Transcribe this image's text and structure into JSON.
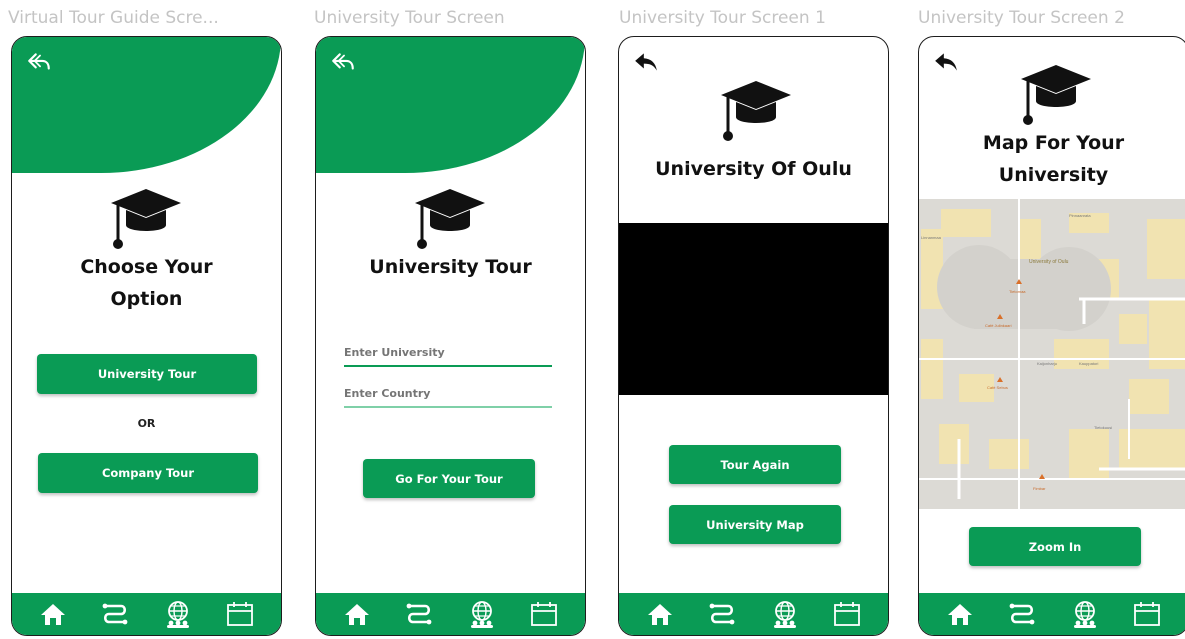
{
  "frames": [
    {
      "label": "Virtual Tour Guide Scre...",
      "title_lines": [
        "Choose Your",
        "Option"
      ],
      "buttons": [
        "University Tour",
        "Company Tour"
      ],
      "or_text": "OR"
    },
    {
      "label": "University Tour Screen",
      "title_lines": [
        "University Tour"
      ],
      "fields": [
        {
          "placeholder": "Enter University"
        },
        {
          "placeholder": "Enter Country"
        }
      ],
      "buttons": [
        "Go For Your Tour"
      ]
    },
    {
      "label": "University Tour Screen 1",
      "title_lines": [
        "University Of Oulu"
      ],
      "buttons": [
        "Tour Again",
        "University Map"
      ]
    },
    {
      "label": "University Tour Screen 2",
      "title_lines": [
        "Map For Your",
        "University"
      ],
      "buttons": [
        "Zoom In"
      ],
      "map_labels": [
        "Pinnaanrata",
        "Linnanmaa",
        "University of Oulu",
        "Tietomaa",
        "Café Julinkaari",
        "Kaijonharju",
        "Kauppatori",
        "Café Sebus",
        "Tietokuusi",
        "Fimbar"
      ]
    }
  ],
  "colors": {
    "primary": "#0a9b55",
    "video": "#000000",
    "map_bg": "#dcdad5",
    "map_building": "#f1e3b1"
  },
  "icons": {
    "back": "back-arrow-icon",
    "cap": "graduation-cap-icon",
    "nav": [
      "home-icon",
      "route-icon",
      "globe-people-icon",
      "calendar-icon"
    ]
  }
}
